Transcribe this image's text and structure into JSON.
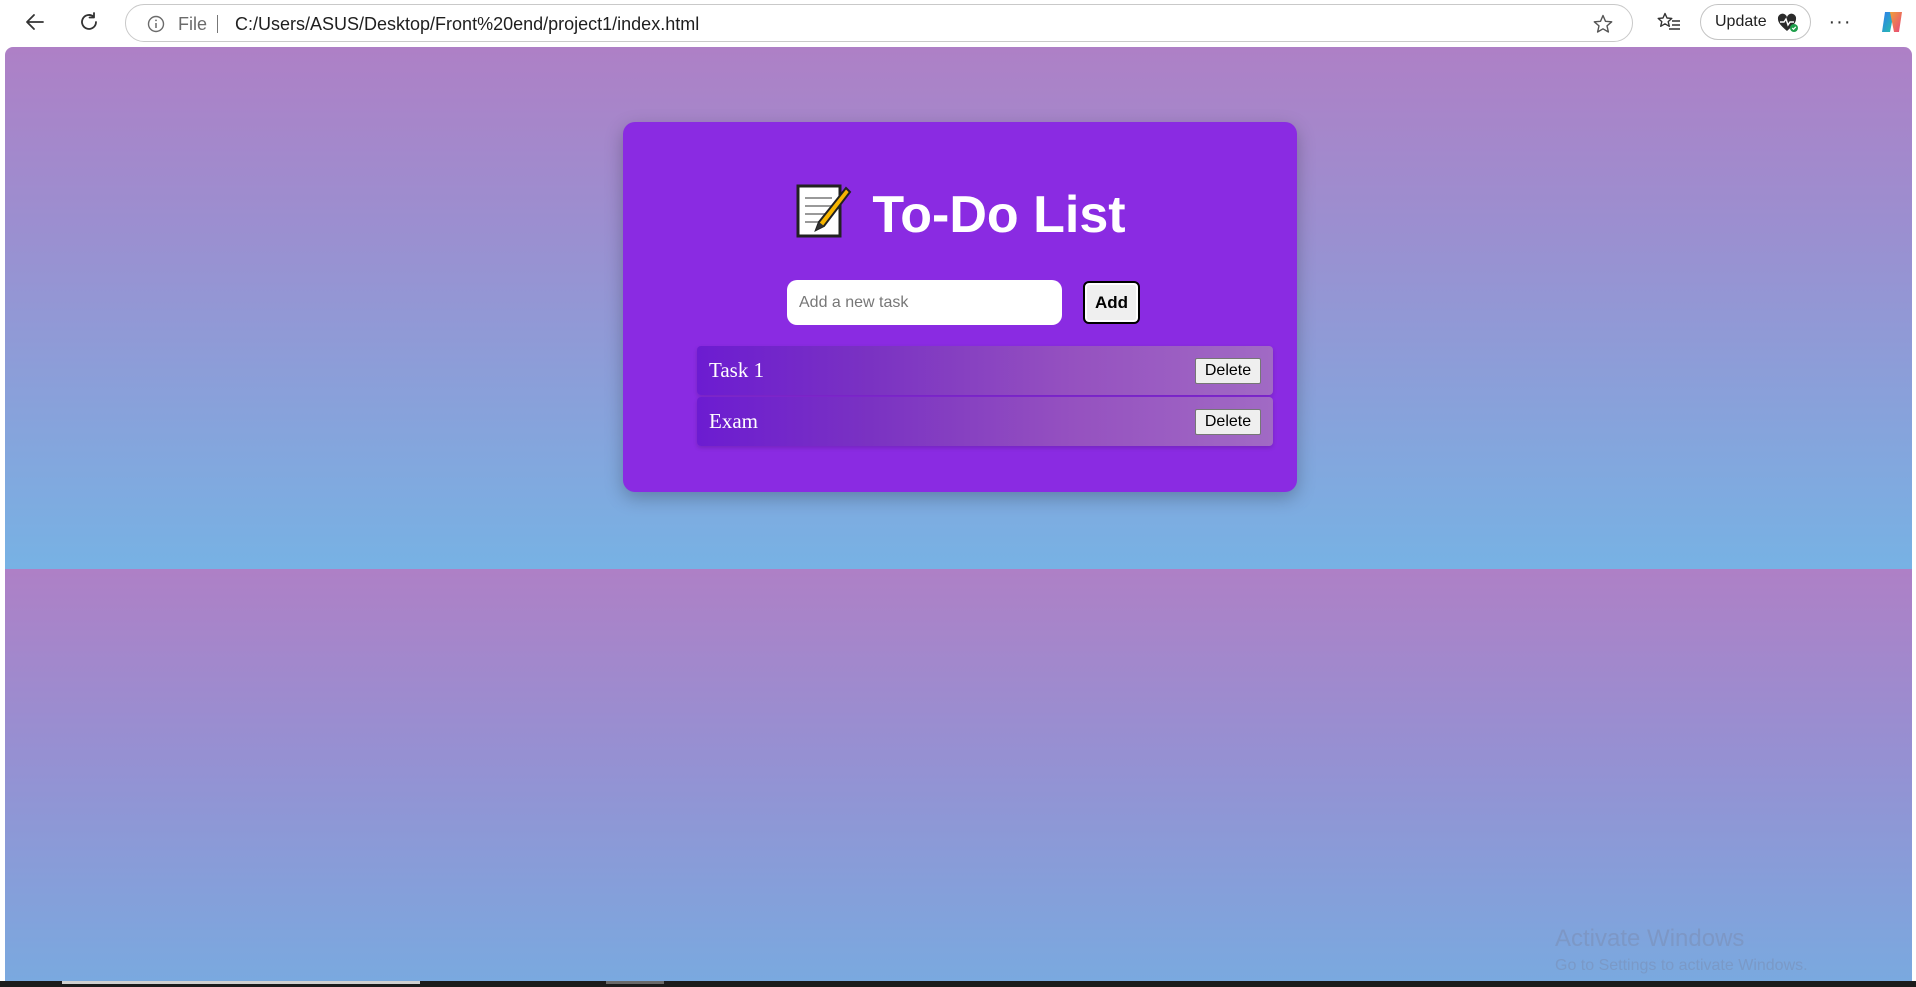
{
  "browser": {
    "scheme_label": "File",
    "url": "C:/Users/ASUS/Desktop/Front%20end/project1/index.html",
    "update_label": "Update",
    "more_label": "···"
  },
  "app": {
    "title": "To-Do List",
    "title_icon": "memo-icon",
    "input": {
      "placeholder": "Add a new task",
      "value": ""
    },
    "add_label": "Add",
    "tasks": [
      {
        "label": "Task 1",
        "delete_label": "Delete"
      },
      {
        "label": "Exam",
        "delete_label": "Delete"
      }
    ],
    "colors": {
      "card": "#8a2be2",
      "background_top": "#ae80c6",
      "background_bottom": "#77b2e4"
    }
  },
  "watermark": {
    "title": "Activate Windows",
    "subtitle": "Go to Settings to activate Windows."
  }
}
